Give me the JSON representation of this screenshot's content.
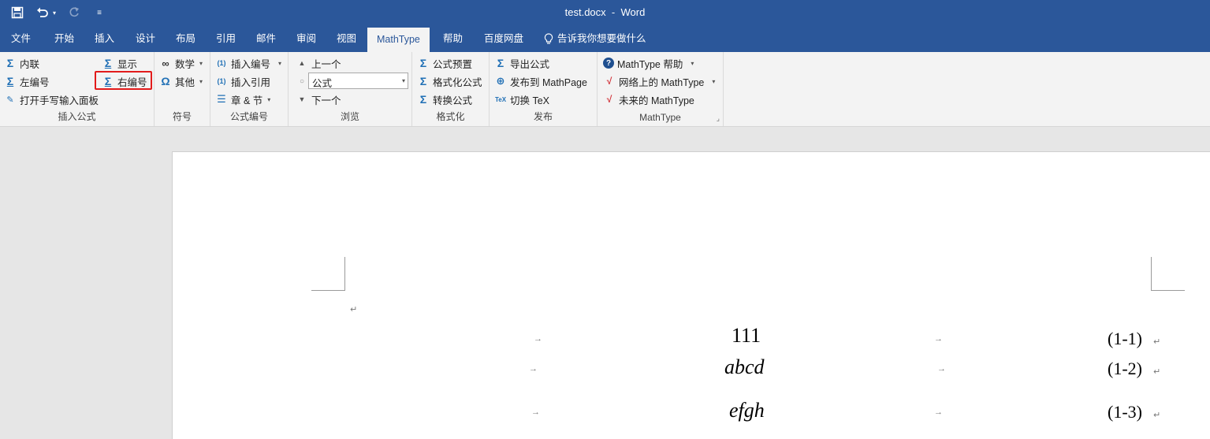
{
  "window": {
    "title": "test.docx",
    "separator": "-",
    "app": "Word"
  },
  "qat": {
    "save_icon": "save-icon",
    "undo_icon": "undo-icon",
    "redo_icon": "redo-icon",
    "customize_icon": "customize-icon"
  },
  "tabs": [
    "文件",
    "开始",
    "插入",
    "设计",
    "布局",
    "引用",
    "邮件",
    "审阅",
    "视图",
    "MathType",
    "帮助",
    "百度网盘"
  ],
  "tell_me": "告诉我你想要做什么",
  "ribbon": {
    "insert_equation": {
      "label": "插入公式",
      "inline": "内联",
      "display": "显示",
      "left_number": "左编号",
      "right_number": "右编号",
      "handwriting": "打开手写输入面板"
    },
    "symbols": {
      "label": "符号",
      "math": "数学",
      "other": "其他"
    },
    "equation_numbers": {
      "label": "公式编号",
      "insert_number": "插入编号",
      "insert_reference": "插入引用",
      "chapter_section": "章 & 节"
    },
    "browse": {
      "label": "浏览",
      "previous": "上一个",
      "combo_value": "公式",
      "next": "下一个"
    },
    "format": {
      "label": "格式化",
      "presets": "公式预置",
      "format_equations": "格式化公式",
      "convert": "转换公式"
    },
    "publish": {
      "label": "发布",
      "export": "导出公式",
      "publish_mathpage": "发布到 MathPage",
      "toggle_tex": "切换 TeX"
    },
    "mathtype": {
      "label": "MathType",
      "help": "MathType 帮助",
      "on_web": "网络上的 MathType",
      "future": "未来的 MathType"
    }
  },
  "document": {
    "paragraph_mark": "↵",
    "tab_mark": "→",
    "equations": [
      {
        "expr": "111",
        "number": "(1-1)"
      },
      {
        "expr": "abcd",
        "number": "(1-2)"
      },
      {
        "expr": "efgh",
        "number": "(1-3)"
      }
    ]
  },
  "colors": {
    "word_blue": "#2b579a",
    "highlight_red": "#e21b1b",
    "icon_blue": "#1f6fb5"
  }
}
